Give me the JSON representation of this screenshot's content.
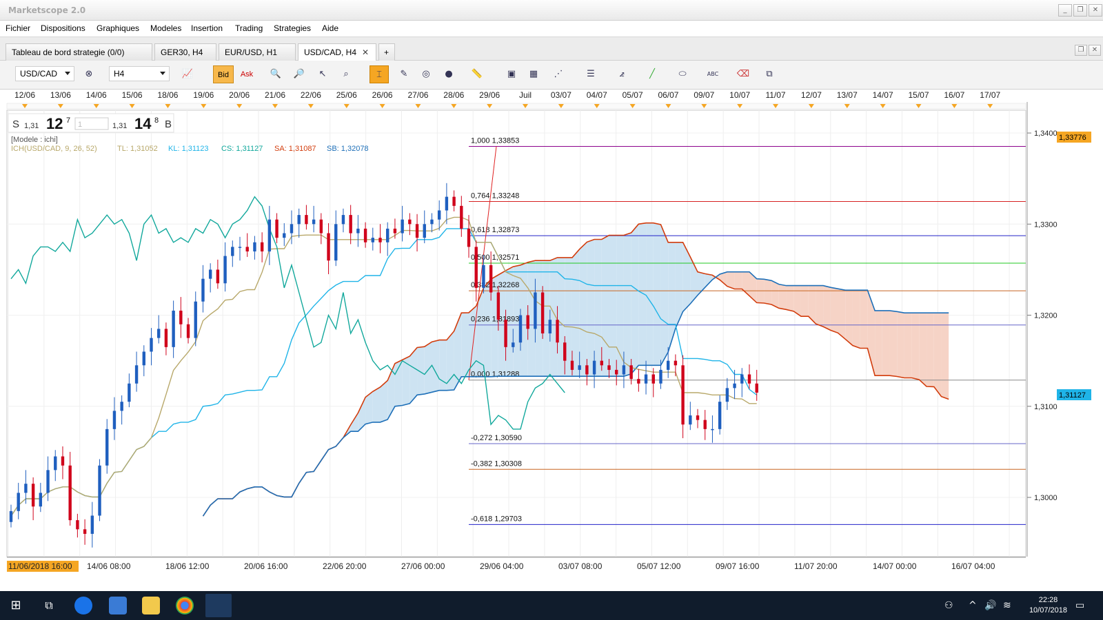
{
  "window": {
    "title": "Marketscope 2.0",
    "min": "_",
    "restore": "❐",
    "close": "✕"
  },
  "menu": [
    "Fichier",
    "Dispositions",
    "Graphiques",
    "Modeles",
    "Insertion",
    "Trading",
    "Strategies",
    "Aide"
  ],
  "tabs": [
    {
      "label": "Tableau de bord strategie (0/0)",
      "close": ""
    },
    {
      "label": "GER30, H4",
      "close": ""
    },
    {
      "label": "EUR/USD, H1",
      "close": ""
    },
    {
      "label": "USD/CAD, H4",
      "close": "✕"
    }
  ],
  "tab_add": "+",
  "toolbar": {
    "instrument": "USD/CAD",
    "timeframe": "H4",
    "bid": "Bid",
    "ask": "Ask"
  },
  "quote": {
    "sell_label": "S",
    "sell_prefix": "1,31",
    "sell_big": "12",
    "sell_sup": "7",
    "qty": "1",
    "buy_prefix": "1,31",
    "buy_big": "14",
    "buy_sup": "8",
    "buy_label": "B"
  },
  "legend": {
    "model": "[Modele : ichi]",
    "ich": "ICH(USD/CAD, 9, 26, 52)",
    "tl": "TL: 1,31052",
    "kl": "KL: 1,31123",
    "cs": "CS: 1,31127",
    "sa": "SA: 1,31087",
    "sb": "SB: 1,32078"
  },
  "top_dates": [
    "12/06",
    "13/06",
    "14/06",
    "15/06",
    "18/06",
    "19/06",
    "20/06",
    "21/06",
    "22/06",
    "25/06",
    "26/06",
    "27/06",
    "28/06",
    "29/06",
    "Juil",
    "03/07",
    "04/07",
    "05/07",
    "06/07",
    "09/07",
    "10/07",
    "11/07",
    "12/07",
    "13/07",
    "14/07",
    "15/07",
    "16/07",
    "17/07"
  ],
  "bottom_dates": [
    "11/06/2018 16:00",
    "14/06 08:00",
    "18/06 12:00",
    "20/06 16:00",
    "22/06 20:00",
    "27/06 00:00",
    "29/06 04:00",
    "03/07 08:00",
    "05/07 12:00",
    "09/07 16:00",
    "11/07 20:00",
    "14/07 00:00",
    "16/07 04:00"
  ],
  "price_ticks": [
    "1,3400",
    "1,3300",
    "1,3200",
    "1,3100",
    "1,3000"
  ],
  "price_markers": {
    "top": "1,33776",
    "current": "1,31127"
  },
  "colors": {
    "up": "#1f5fbf",
    "down": "#d0021b",
    "tenkan": "#b8a86a",
    "kijun": "#1fb4e8",
    "chikou": "#12a89c",
    "span_a": "#d23c0c",
    "span_b": "#1d6fb8",
    "cloud_bull": "#cde3f2",
    "cloud_bear": "#f6d3c6"
  },
  "fibo": [
    {
      "label": "1,000 1,33853",
      "price": 1.33853,
      "color": "#8b008b"
    },
    {
      "label": "0,764 1,33248",
      "price": 1.33248,
      "color": "#d62020"
    },
    {
      "label": "0,618 1,32873",
      "price": 1.32873,
      "color": "#2020c8"
    },
    {
      "label": "0,500 1,32571",
      "price": 1.32571,
      "color": "#20c820"
    },
    {
      "label": "0,382 1,32268",
      "price": 1.32268,
      "color": "#c86420"
    },
    {
      "label": "0,236 1,31893",
      "price": 1.31893,
      "color": "#6464c8"
    },
    {
      "label": "0,000 1,31288",
      "price": 1.31288,
      "color": "#888888"
    },
    {
      "label": "-0,272 1,30590",
      "price": 1.3059,
      "color": "#6464c8"
    },
    {
      "label": "-0,382 1,30308",
      "price": 1.30308,
      "color": "#c86420"
    },
    {
      "label": "-0,618 1,29703",
      "price": 1.29703,
      "color": "#2020c8"
    }
  ],
  "chart_data": {
    "type": "candlestick",
    "symbol": "USD/CAD",
    "timeframe": "H4",
    "ylim": [
      1.2935,
      1.3425
    ],
    "close_path": [
      1.2985,
      1.3005,
      1.3015,
      1.299,
      1.3005,
      1.303,
      1.3045,
      1.3035,
      1.2975,
      1.2965,
      1.296,
      1.298,
      1.3035,
      1.3075,
      1.3095,
      1.3105,
      1.3125,
      1.3145,
      1.316,
      1.3175,
      1.3185,
      1.3165,
      1.3205,
      1.319,
      1.3175,
      1.3215,
      1.324,
      1.325,
      1.3235,
      1.3265,
      1.3275,
      1.3275,
      1.327,
      1.328,
      1.327,
      1.3305,
      1.3285,
      1.329,
      1.33,
      1.331,
      1.33,
      1.3305,
      1.329,
      1.326,
      1.33,
      1.331,
      1.329,
      1.3295,
      1.328,
      1.3285,
      1.328,
      1.3295,
      1.329,
      1.3305,
      1.33,
      1.3285,
      1.33,
      1.3305,
      1.3315,
      1.333,
      1.332,
      1.3295,
      1.3275,
      1.323,
      1.3255,
      1.3225,
      1.3195,
      1.3165,
      1.317,
      1.32,
      1.3185,
      1.3225,
      1.318,
      1.3195,
      1.317,
      1.315,
      1.314,
      1.3145,
      1.3135,
      1.315,
      1.3145,
      1.314,
      1.3135,
      1.3145,
      1.313,
      1.3125,
      1.3135,
      1.3125,
      1.314,
      1.315,
      1.3145,
      1.308,
      1.309,
      1.3085,
      1.3075,
      1.3075,
      1.3105,
      1.312,
      1.3125,
      1.3135,
      1.3125,
      1.3115
    ],
    "kijun": {
      "ylim_ref": true
    },
    "current_price": 1.31127
  }
}
